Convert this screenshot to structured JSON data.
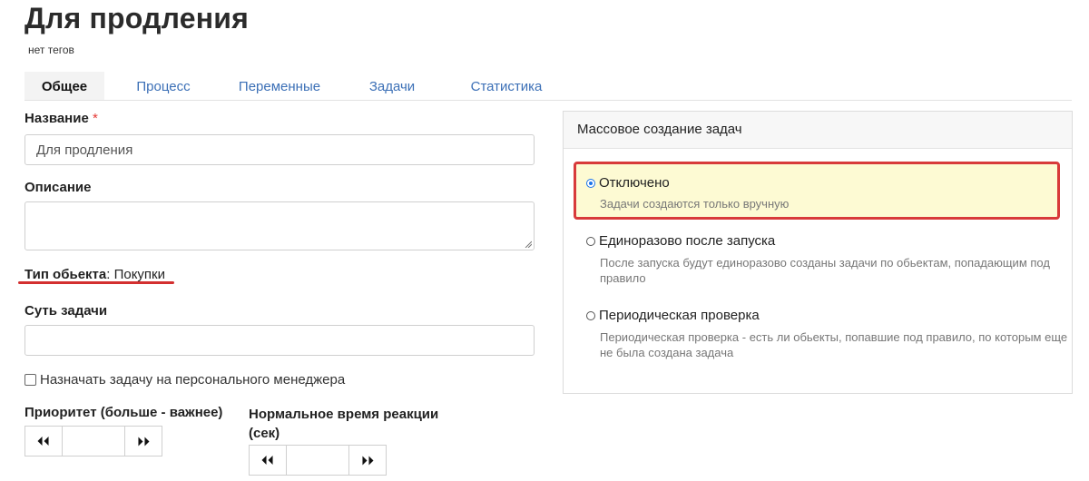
{
  "page": {
    "title": "Для продления",
    "tags_text": "нет тегов"
  },
  "tabs": [
    {
      "label": "Общее",
      "active": true
    },
    {
      "label": "Процесс",
      "active": false
    },
    {
      "label": "Переменные",
      "active": false
    },
    {
      "label": "Задачи",
      "active": false
    },
    {
      "label": "Статистика",
      "active": false
    }
  ],
  "form": {
    "name_label": "Название",
    "required_mark": "*",
    "name_value": "Для продления",
    "description_label": "Описание",
    "description_value": "",
    "object_type_label": "Тип обьекта",
    "object_type_sep": ":",
    "object_type_value": "Покупки",
    "task_essence_label": "Суть задачи",
    "task_essence_value": "",
    "assign_manager_label": "Назначать задачу на персонального менеджера",
    "assign_manager_checked": false,
    "priority_label": "Приоритет (больше - важнее)",
    "priority_value": "",
    "reaction_label_line1": "Нормальное время реакции",
    "reaction_label_line2": "(сек)",
    "reaction_value": "",
    "stepper_dec_icon": "⏴⏴",
    "stepper_inc_icon": "⏵⏵"
  },
  "mass_panel": {
    "title": "Массовое создание задач",
    "selected_index": 0,
    "options": [
      {
        "label": "Отключено",
        "desc_line1": "Задачи создаются только вручную",
        "desc_line2": ""
      },
      {
        "label": "Единоразово после запуска",
        "desc_line1": "После запуска будут единоразово созданы задачи по обьектам, попадающим под",
        "desc_line2": "правило"
      },
      {
        "label": "Периодическая проверка",
        "desc_line1": "Периодическая проверка - есть ли обьекты, попавшие под правило, по которым еще",
        "desc_line2": "не была создана задача"
      }
    ]
  },
  "colors": {
    "accent_link": "#3b6fb6",
    "highlight_border": "#d83a3a",
    "highlight_bg": "#fdfad3",
    "required": "#e53935"
  }
}
